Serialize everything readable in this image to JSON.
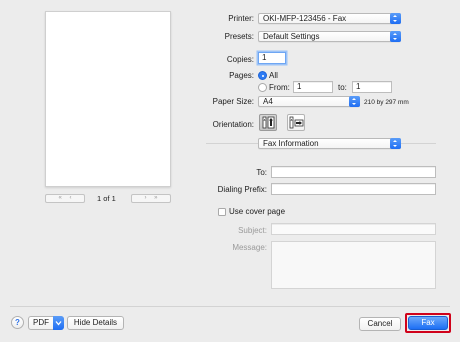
{
  "preview": {
    "page_label": "1 of 1",
    "nav_first": "«",
    "nav_prev": "‹",
    "nav_next": "›",
    "nav_last": "»"
  },
  "printer": {
    "label": "Printer:",
    "value": "OKI-MFP-123456 - Fax"
  },
  "presets": {
    "label": "Presets:",
    "value": "Default Settings"
  },
  "copies": {
    "label": "Copies:",
    "value": "1"
  },
  "pages": {
    "label": "Pages:",
    "all_label": "All",
    "from_label": "From:",
    "from_value": "1",
    "to_label": "to:",
    "to_value": "1",
    "selected": "All"
  },
  "paper_size": {
    "label": "Paper Size:",
    "value": "A4",
    "dimensions": "210 by 297 mm"
  },
  "orientation": {
    "label": "Orientation:",
    "selected": "portrait",
    "portrait_icon": "portrait-orientation-icon",
    "landscape_icon": "landscape-orientation-icon"
  },
  "section": {
    "value": "Fax Information"
  },
  "fax": {
    "to_label": "To:",
    "to_value": "",
    "prefix_label": "Dialing Prefix:",
    "prefix_value": "",
    "cover_label": "Use cover page",
    "cover_checked": false,
    "subject_label": "Subject:",
    "subject_value": "",
    "message_label": "Message:",
    "message_value": ""
  },
  "footer": {
    "help": "?",
    "pdf": "PDF",
    "hide_details": "Hide Details",
    "cancel": "Cancel",
    "fax": "Fax"
  },
  "colors": {
    "accent": "#1d6ff4",
    "highlight_border": "#d0021b",
    "window_bg": "#ececec"
  }
}
